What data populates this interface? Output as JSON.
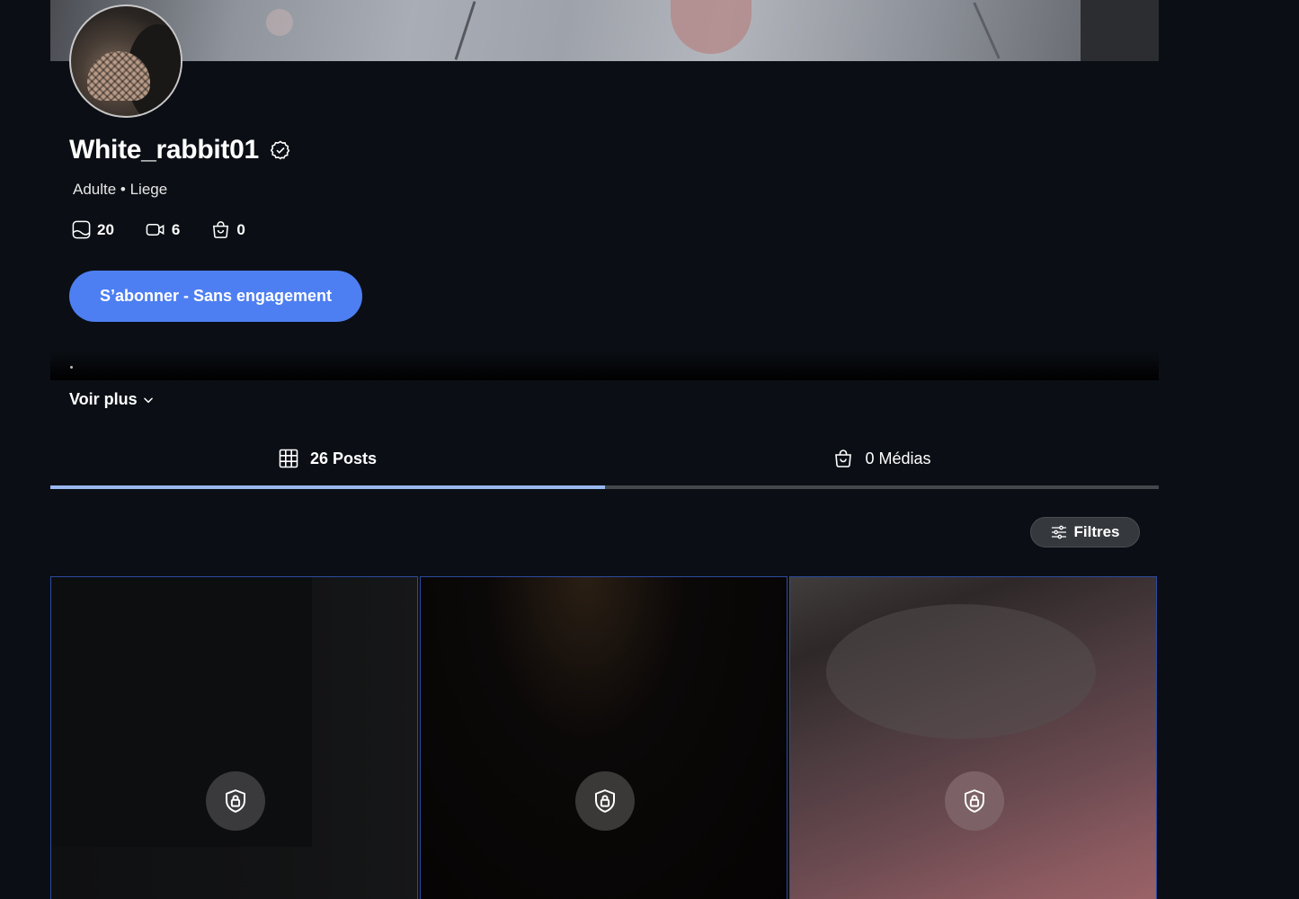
{
  "profile": {
    "username": "White_rabbit01",
    "subtitle": "Adulte • Liege",
    "stats": {
      "photos": "20",
      "videos": "6",
      "shop": "0"
    }
  },
  "subscribe": {
    "label": "S’abonner - Sans engagement"
  },
  "bio": {
    "see_more_label": "Voir plus"
  },
  "tabs": [
    {
      "label": "26 Posts",
      "active": true,
      "icon": "grid-icon"
    },
    {
      "label": "0 Médias",
      "active": false,
      "icon": "shopping-bag-icon"
    }
  ],
  "filters": {
    "label": "Filtres"
  },
  "posts": [
    {
      "locked": true,
      "icon": "lock-shield-icon"
    },
    {
      "locked": true,
      "icon": "lock-shield-icon"
    },
    {
      "locked": true,
      "icon": "lock-shield-icon"
    }
  ],
  "colors": {
    "background": "#0b0f15",
    "accent": "#4d7ff2",
    "tab_indicator": "#9ab8f0",
    "card_border": "#2d4aa0"
  }
}
